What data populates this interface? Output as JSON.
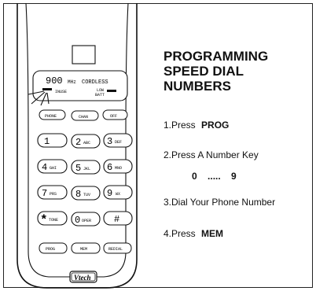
{
  "phone": {
    "display_freq": "900",
    "display_mhz": "MHz",
    "display_cordless": "CORDLESS",
    "in_use_label": "INUSE",
    "low_batt_line1": "LOW",
    "low_batt_line2": "BATT",
    "func_keys": [
      "PHONE",
      "CHAN",
      "OFF"
    ],
    "keypad": [
      [
        {
          "main": "1",
          "sub": ""
        },
        {
          "main": "2",
          "sub": "ABC"
        },
        {
          "main": "3",
          "sub": "DEF"
        }
      ],
      [
        {
          "main": "4",
          "sub": "GHI"
        },
        {
          "main": "5",
          "sub": "JKL"
        },
        {
          "main": "6",
          "sub": "MNO"
        }
      ],
      [
        {
          "main": "7",
          "sub": "PRS"
        },
        {
          "main": "8",
          "sub": "TUV"
        },
        {
          "main": "9",
          "sub": "WX"
        }
      ],
      [
        {
          "main": "*",
          "sub": "TONE"
        },
        {
          "main": "0",
          "sub": "OPER"
        },
        {
          "main": "#",
          "sub": ""
        }
      ]
    ],
    "bottom_keys": [
      "PROG",
      "MEM",
      "REDIAL"
    ],
    "brand": "Vtech"
  },
  "instructions": {
    "title_lines": [
      "PROGRAMMING",
      "SPEED DIAL",
      "NUMBERS"
    ],
    "step1_text": "1.Press",
    "step1_key": "PROG",
    "step2_text": "2.Press A  Number Key",
    "digit_from": "0",
    "digit_dots": ".....",
    "digit_to": "9",
    "step3_text": "3.Dial Your Phone Number",
    "step4_text": "4.Press",
    "step4_key": "MEM"
  }
}
